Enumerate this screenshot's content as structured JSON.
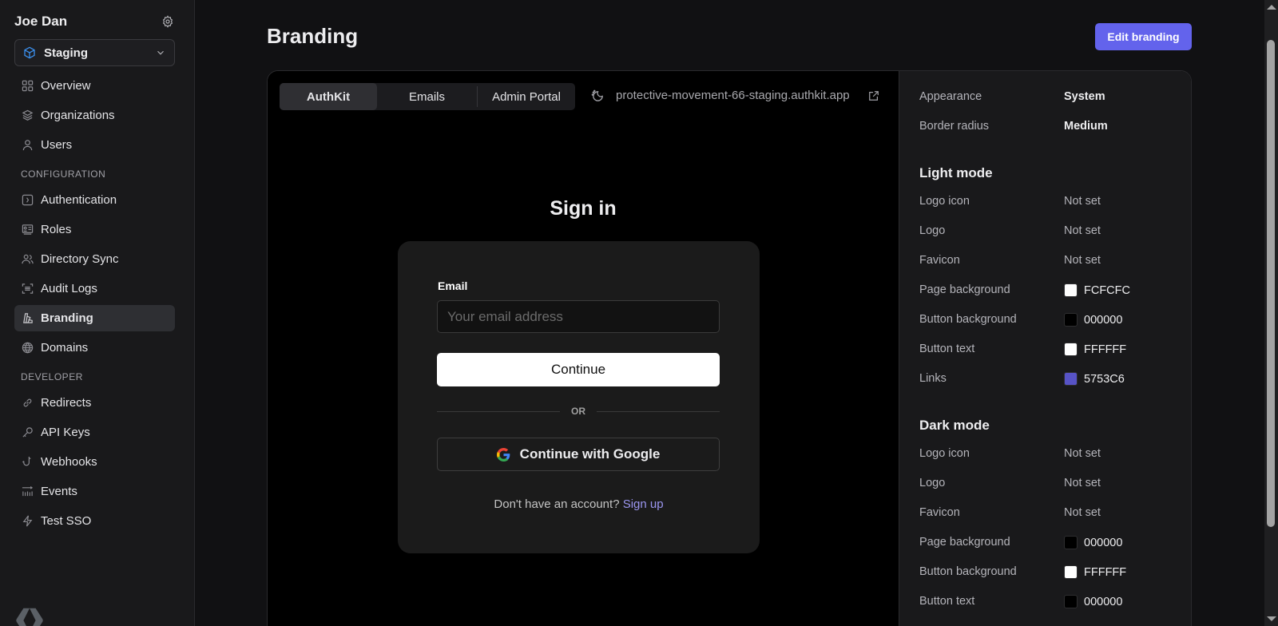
{
  "sidebar": {
    "user_name": "Joe Dan",
    "environment": "Staging",
    "items_top": [
      {
        "label": "Overview",
        "icon": "grid-icon"
      },
      {
        "label": "Organizations",
        "icon": "layers-icon"
      },
      {
        "label": "Users",
        "icon": "user-icon"
      }
    ],
    "section_configuration": "CONFIGURATION",
    "items_config": [
      {
        "label": "Authentication",
        "icon": "auth-icon"
      },
      {
        "label": "Roles",
        "icon": "id-card-icon"
      },
      {
        "label": "Directory Sync",
        "icon": "users-icon"
      },
      {
        "label": "Audit Logs",
        "icon": "scan-icon"
      },
      {
        "label": "Branding",
        "icon": "swatch-icon",
        "active": true
      },
      {
        "label": "Domains",
        "icon": "globe-icon"
      }
    ],
    "section_developer": "DEVELOPER",
    "items_dev": [
      {
        "label": "Redirects",
        "icon": "link-icon"
      },
      {
        "label": "API Keys",
        "icon": "key-icon"
      },
      {
        "label": "Webhooks",
        "icon": "hook-icon"
      },
      {
        "label": "Events",
        "icon": "events-icon"
      },
      {
        "label": "Test SSO",
        "icon": "bolt-icon"
      }
    ]
  },
  "header": {
    "title": "Branding",
    "edit_button": "Edit branding"
  },
  "preview": {
    "tabs": [
      "AuthKit",
      "Emails",
      "Admin Portal"
    ],
    "active_tab": "AuthKit",
    "url": "protective-movement-66-staging.authkit.app",
    "signin_title": "Sign in",
    "email_label": "Email",
    "email_placeholder": "Your email address",
    "email_value": "",
    "continue_label": "Continue",
    "or_label": "OR",
    "google_label": "Continue with Google",
    "signup_prompt": "Don't have an account?",
    "signup_link": "Sign up"
  },
  "settings": {
    "general": [
      {
        "key": "Appearance",
        "value": "System"
      },
      {
        "key": "Border radius",
        "value": "Medium"
      }
    ],
    "light_mode_title": "Light mode",
    "light_mode": [
      {
        "key": "Logo icon",
        "value": "Not set"
      },
      {
        "key": "Logo",
        "value": "Not set"
      },
      {
        "key": "Favicon",
        "value": "Not set"
      },
      {
        "key": "Page background",
        "value": "FCFCFC",
        "color": "#FCFCFC"
      },
      {
        "key": "Button background",
        "value": "000000",
        "color": "#000000"
      },
      {
        "key": "Button text",
        "value": "FFFFFF",
        "color": "#FFFFFF"
      },
      {
        "key": "Links",
        "value": "5753C6",
        "color": "#5753C6"
      }
    ],
    "dark_mode_title": "Dark mode",
    "dark_mode": [
      {
        "key": "Logo icon",
        "value": "Not set"
      },
      {
        "key": "Logo",
        "value": "Not set"
      },
      {
        "key": "Favicon",
        "value": "Not set"
      },
      {
        "key": "Page background",
        "value": "000000",
        "color": "#000000"
      },
      {
        "key": "Button background",
        "value": "FFFFFF",
        "color": "#FFFFFF"
      },
      {
        "key": "Button text",
        "value": "000000",
        "color": "#000000"
      }
    ]
  },
  "colors": {
    "accent": "#6363EC",
    "link_preview": "#9B96F0"
  }
}
